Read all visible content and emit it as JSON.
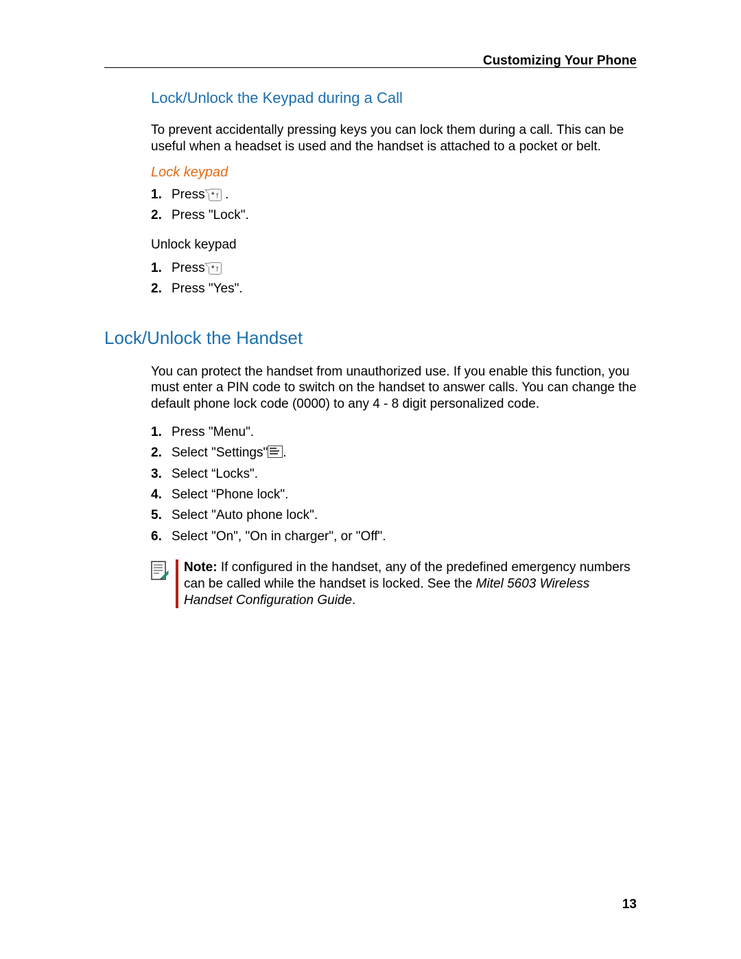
{
  "header": {
    "running_title": "Customizing Your Phone"
  },
  "section1": {
    "title": "Lock/Unlock the Keypad during a Call",
    "intro": "To prevent accidentally pressing keys you can lock them during a call. This can be useful when a headset is used and the handset is attached to a pocket or belt.",
    "sub1_title": "Lock keypad",
    "lock_steps": [
      {
        "num": "1.",
        "pre": "Press  ",
        "icon": "star-key",
        "post": " ."
      },
      {
        "num": "2.",
        "text": "Press \"Lock\"."
      }
    ],
    "unlock_label": "Unlock keypad",
    "unlock_steps": [
      {
        "num": "1.",
        "pre": "Press  ",
        "icon": "star-key",
        "post": ""
      },
      {
        "num": "2.",
        "text": "Press \"Yes\"."
      }
    ]
  },
  "section2": {
    "title": "Lock/Unlock the Handset",
    "intro": "You can protect the handset from unauthorized use. If you enable this function, you must enter a PIN code to switch on the handset to answer calls. You can change the default phone lock code (0000) to any 4 - 8 digit personalized code.",
    "steps": [
      {
        "num": "1.",
        "text": "Press \"Menu\"."
      },
      {
        "num": "2.",
        "pre": "Select \"Settings\"",
        "icon": "settings-icon",
        "post": "."
      },
      {
        "num": "3.",
        "text": "Select “Locks\"."
      },
      {
        "num": "4.",
        "text": "Select “Phone lock\"."
      },
      {
        "num": "5.",
        "text": "Select \"Auto phone lock\"."
      },
      {
        "num": "6.",
        "text": "Select \"On\", \"On in charger\", or \"Off\"."
      }
    ],
    "note": {
      "bold": "Note: ",
      "body": "If configured in the handset, any of the predefined emergency numbers can be called while the handset is locked. See the ",
      "ital": "Mitel 5603 Wireless Handset Configuration Guide",
      "tail": "."
    }
  },
  "page_number": "13",
  "icons": {
    "star_key_label": "* ↑"
  }
}
